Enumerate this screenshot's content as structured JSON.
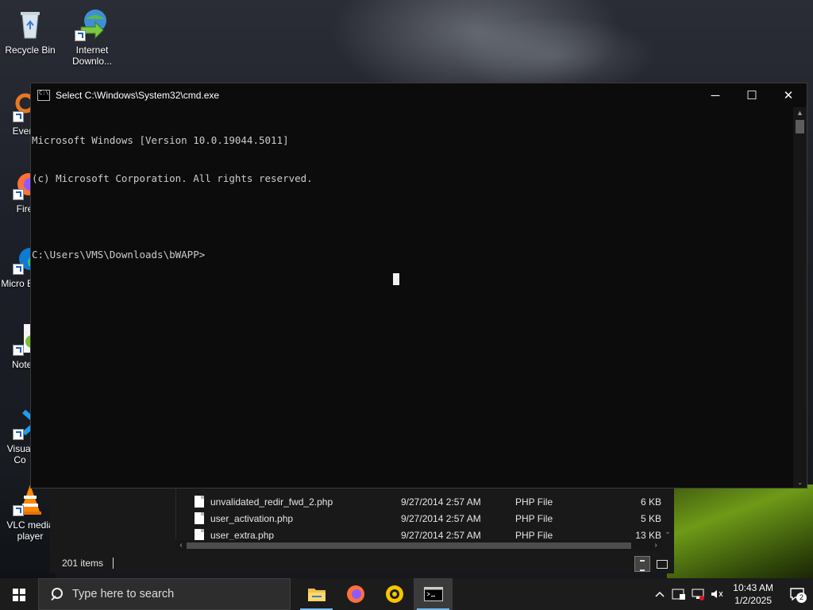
{
  "desktop": {
    "icons": [
      {
        "label": "Recycle Bin"
      },
      {
        "label": "Internet Downlo..."
      },
      {
        "label": "Every"
      },
      {
        "label": "Fire"
      },
      {
        "label": "Micro Ed"
      },
      {
        "label": "Notep"
      },
      {
        "label": "Visual Co"
      },
      {
        "label": "VLC media player"
      }
    ]
  },
  "cmd_window": {
    "title": "Select C:\\Windows\\System32\\cmd.exe",
    "controls": {
      "minimize": "─",
      "maximize": "☐",
      "close": "✕"
    },
    "lines": [
      "Microsoft Windows [Version 10.0.19044.5011]",
      "(c) Microsoft Corporation. All rights reserved.",
      "",
      "C:\\Users\\VMS\\Downloads\\bWAPP>"
    ]
  },
  "explorer": {
    "files": [
      {
        "name": "unvalidated_redir_fwd_2.php",
        "date": "9/27/2014 2:57 AM",
        "type": "PHP File",
        "size": "6 KB"
      },
      {
        "name": "user_activation.php",
        "date": "9/27/2014 2:57 AM",
        "type": "PHP File",
        "size": "5 KB"
      },
      {
        "name": "user_extra.php",
        "date": "9/27/2014 2:57 AM",
        "type": "PHP File",
        "size": "13 KB"
      }
    ],
    "status_count": "201 items"
  },
  "taskbar": {
    "search_placeholder": "Type here to search",
    "apps": [
      "File Explorer",
      "Firefox",
      "App",
      "Command Prompt"
    ],
    "clock_time": "10:43 AM",
    "clock_date": "1/2/2025",
    "notification_count": "2"
  },
  "colors": {
    "terminal_bg": "#0c0c0c",
    "terminal_text": "#cccccc",
    "taskbar_bg": "#1c1c1c",
    "accent": "#76b9ed"
  }
}
